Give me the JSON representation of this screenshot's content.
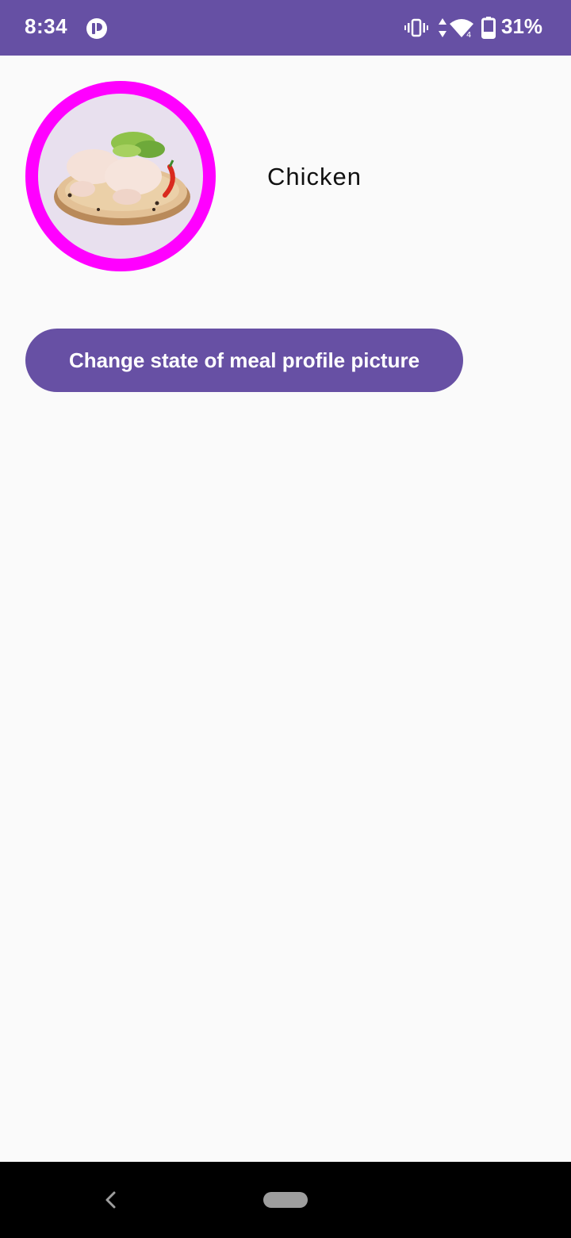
{
  "status_bar": {
    "time": "8:34",
    "battery_percent": "31%",
    "background_color": "#6650a4",
    "icons": [
      "app-notification-icon",
      "vibrate-icon",
      "data-arrows-icon",
      "wifi-icon",
      "battery-icon"
    ]
  },
  "meal": {
    "name": "Chicken",
    "image_description": "raw chicken legs on wooden board with lettuce and chili",
    "ring_color": "#ff00ff"
  },
  "actions": {
    "change_button_label": "Change state of meal profile picture",
    "button_color": "#6750a4"
  },
  "nav_bar": {
    "icons": [
      "back-icon",
      "home-pill"
    ]
  }
}
